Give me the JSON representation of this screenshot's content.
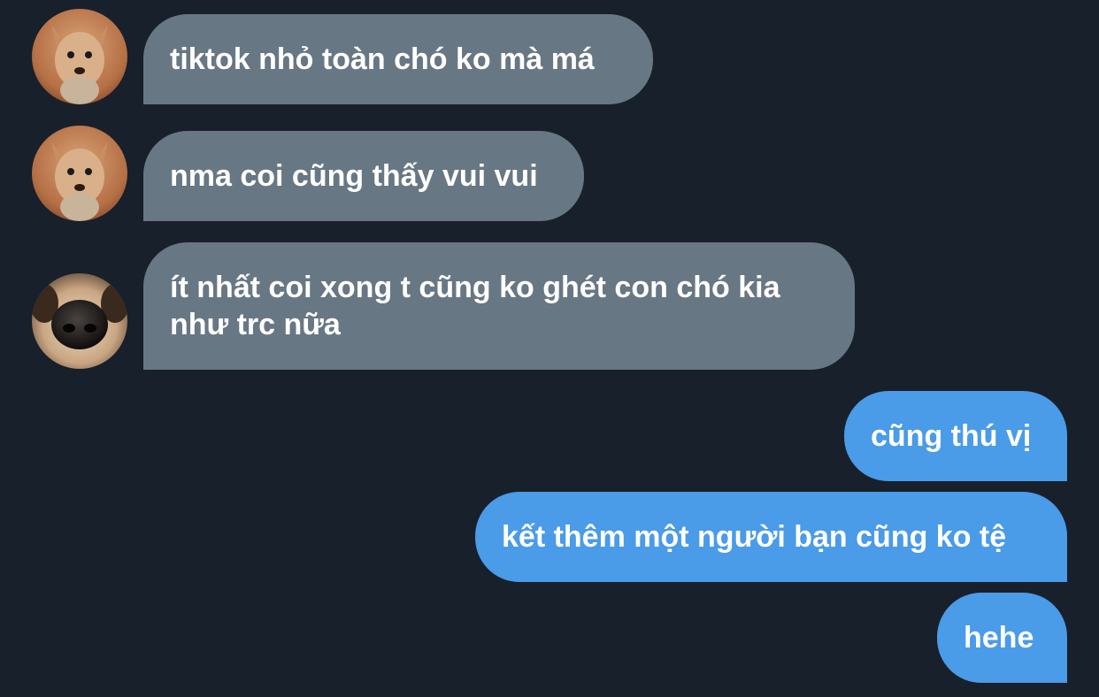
{
  "messages": [
    {
      "direction": "incoming",
      "avatar": "chihuahua-avatar",
      "text": "tiktok nhỏ toàn chó ko mà má"
    },
    {
      "direction": "incoming",
      "avatar": "chihuahua-avatar",
      "text": "nma coi cũng thấy vui vui"
    },
    {
      "direction": "incoming",
      "avatar": "dog-nose-avatar",
      "text": "ít nhất coi xong t cũng ko ghét con chó kia như trc nữa"
    },
    {
      "direction": "outgoing",
      "text": "cũng thú vị"
    },
    {
      "direction": "outgoing",
      "text": "kết thêm một người bạn cũng ko tệ"
    },
    {
      "direction": "outgoing",
      "text": "hehe"
    }
  ],
  "colors": {
    "background": "#18202b",
    "incoming_bubble": "#687784",
    "outgoing_bubble": "#4a9be8",
    "text": "#ffffff"
  }
}
